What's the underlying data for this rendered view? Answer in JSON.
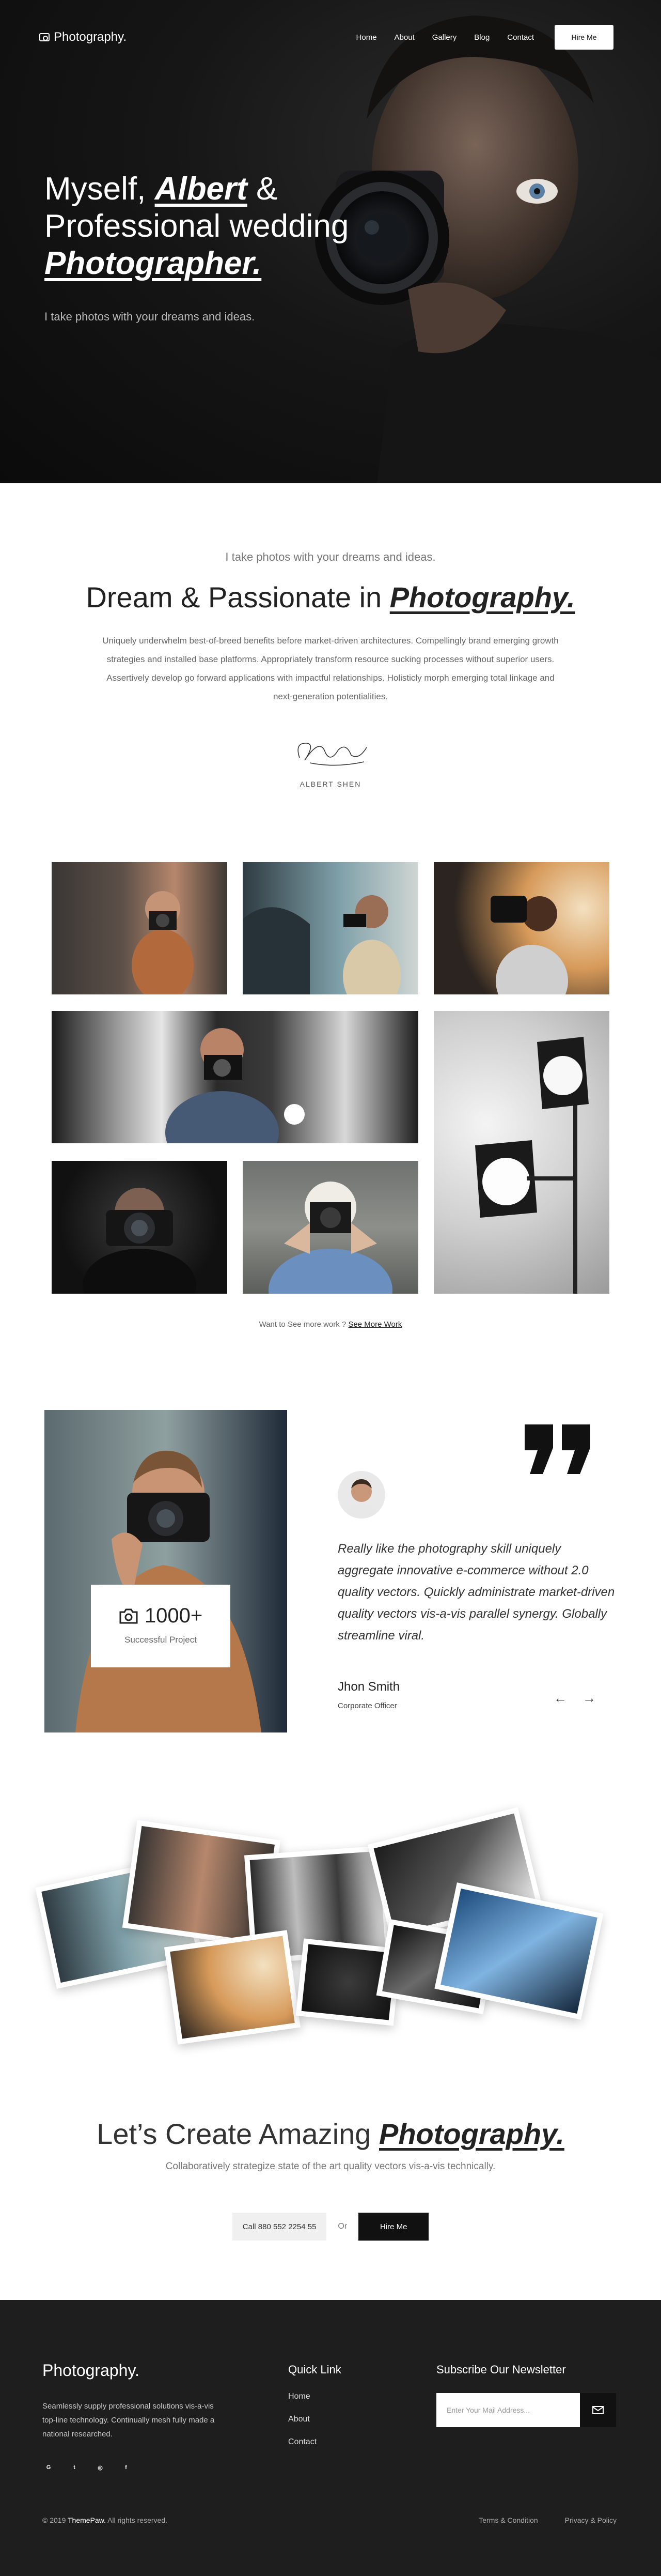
{
  "nav": {
    "logo": "Photography.",
    "items": [
      "Home",
      "About",
      "Gallery",
      "Blog",
      "Contact"
    ],
    "hire": "Hire Me"
  },
  "hero": {
    "line1a": "Myself,",
    "line1b": "Albert",
    "line1c": "&",
    "line2": "Professional wedding",
    "line3": "Photographer.",
    "sub": "I take photos with your dreams and ideas."
  },
  "intro": {
    "kicker": "I take photos with your dreams and ideas.",
    "title_a": "Dream & Passionate in",
    "title_b": "Photography.",
    "body": "Uniquely underwhelm best-of-breed benefits before market-driven architectures. Compellingly brand emerging growth strategies and installed base platforms. Appropriately transform resource sucking processes without superior users. Assertively develop go forward applications with impactful relationships. Holisticly morph emerging total linkage and next-generation potentialities.",
    "signature_name": "ALBERT SHEN"
  },
  "gallery": {
    "more_text": "Want to See more work ?",
    "more_link": "See More Work"
  },
  "counter": {
    "value": "1000+",
    "label": "Successful Project"
  },
  "testimonial": {
    "text": "Really like the photography skill uniquely aggregate innovative e-commerce without 2.0 quality vectors. Quickly administrate market-driven quality vectors vis-a-vis parallel synergy. Globally streamline viral.",
    "name": "Jhon Smith",
    "role": "Corporate Officer",
    "prev": "←",
    "next": "→"
  },
  "cta": {
    "title_a": "Let’s Create Amazing",
    "title_b": "Photography.",
    "sub": "Collaboratively strategize state of the art quality vectors vis-a-vis technically.",
    "call": "Call 880 552 2254 55",
    "or": "Or",
    "hire": "Hire Me"
  },
  "footer": {
    "logo": "Photography.",
    "desc": "Seamlessly supply professional solutions vis-a-vis top-line technology. Continually mesh fully made a national researched.",
    "socials": [
      "G",
      "t",
      "◎",
      "f"
    ],
    "quick_title": "Quick Link",
    "quick_links": [
      "Home",
      "About",
      "Contact"
    ],
    "newsletter_title": "Subscribe Our Newsletter",
    "email_placeholder": "Enter Your Mail Address...",
    "copyright_a": "© 2019",
    "copyright_brand": "ThemePaw.",
    "copyright_b": "All rights reserved.",
    "terms": "Terms & Condition",
    "privacy": "Privacy & Policy"
  }
}
